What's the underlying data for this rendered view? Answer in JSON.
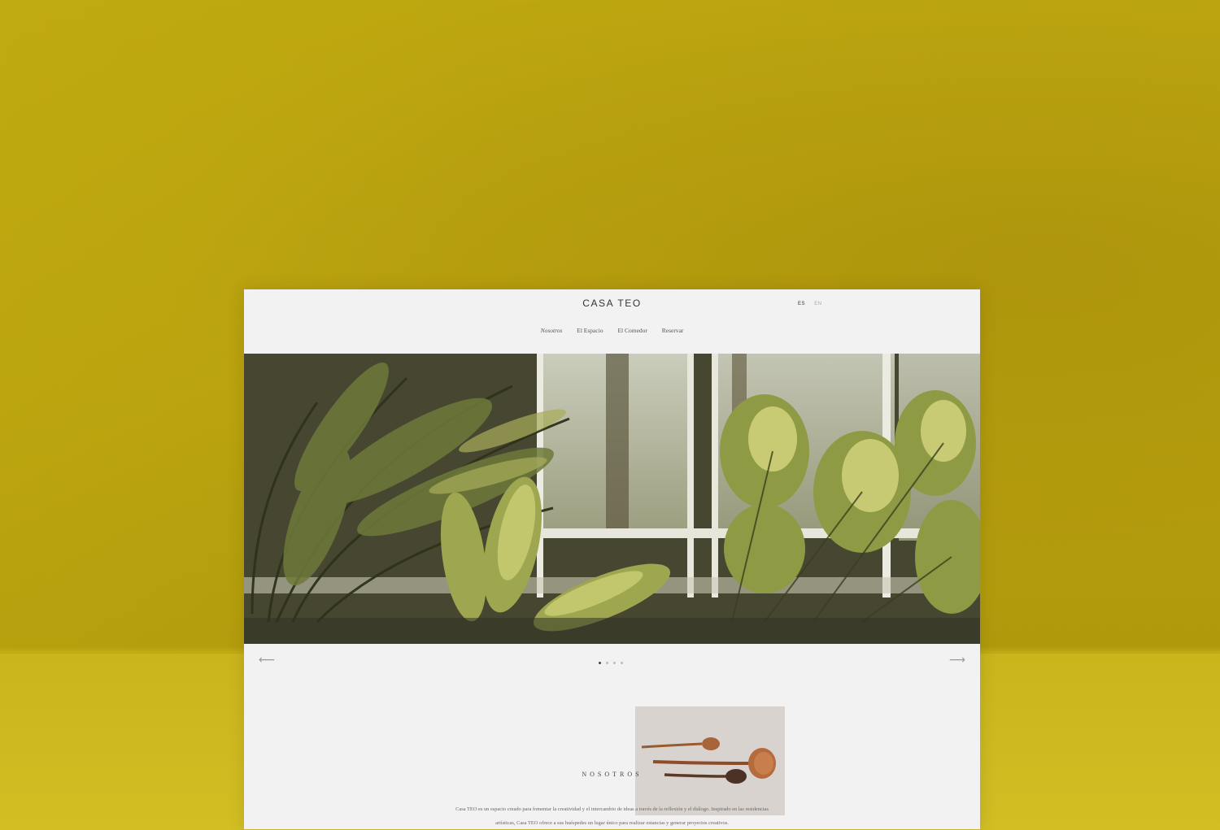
{
  "site": {
    "logo": "CASA TEO",
    "languages": [
      {
        "code": "ES",
        "active": true
      },
      {
        "code": "EN",
        "active": false
      }
    ],
    "nav": [
      {
        "label": "Nosotros",
        "current": true
      },
      {
        "label": "El Espacio",
        "current": false
      },
      {
        "label": "El Comedor",
        "current": false
      },
      {
        "label": "Reservar",
        "current": false
      }
    ]
  },
  "slider": {
    "prev_icon": "arrow-left-icon",
    "next_icon": "arrow-right-icon",
    "prev_glyph": "⟵",
    "next_glyph": "⟶",
    "slide_count": 4,
    "active_index": 0
  },
  "about": {
    "title": "NOSOTROS",
    "text": "Casa TEO es un espacio creado para fomentar la creatividad y el intercambio de ideas a través de la reflexión y el diálogo. Inspirado en las residencias artísticas, Casa TEO ofrece a sus huéspedes un lugar único para realizar estancias y generar proyectos creativos."
  },
  "colors": {
    "background": "#bda710",
    "page": "#f3f2f2",
    "accent_dot": "#444444"
  }
}
